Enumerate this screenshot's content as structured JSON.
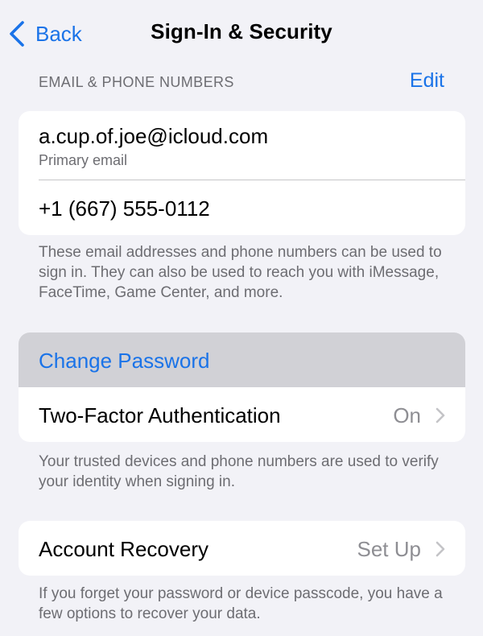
{
  "theme": {
    "accent": "#1a73e8"
  },
  "nav": {
    "back_label": "Back",
    "back_icon": "chevron-left-icon",
    "title": "Sign-In & Security"
  },
  "email_section": {
    "header": "EMAIL & PHONE NUMBERS",
    "edit_label": "Edit",
    "email": "a.cup.of.joe@icloud.com",
    "email_caption": "Primary email",
    "phone": "+1 (667) 555-0112",
    "footnote": "These email addresses and phone numbers can be used to sign in. They can also be used to reach you with iMessage, FaceTime, Game Center, and more."
  },
  "security_section": {
    "change_password_label": "Change Password",
    "two_factor_label": "Two-Factor Authentication",
    "two_factor_value": "On",
    "chevron_icon": "chevron-right-icon",
    "footnote": "Your trusted devices and phone numbers are used to verify your identity when signing in."
  },
  "recovery_section": {
    "label": "Account Recovery",
    "value": "Set Up",
    "chevron_icon": "chevron-right-icon",
    "footnote": "If you forget your password or device passcode, you have a few options to recover your data."
  }
}
